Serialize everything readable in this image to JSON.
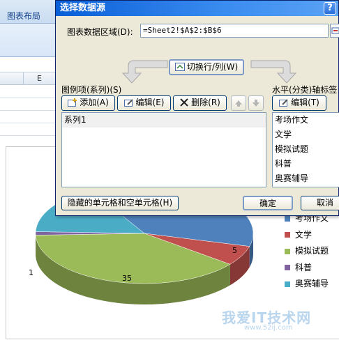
{
  "excel": {
    "ribbon_tab": "图表布局",
    "column_header": "E"
  },
  "dialog": {
    "title": "选择数据源",
    "help": "?",
    "range_label": "图表数据区域(D):",
    "range_value": "=Sheet2!$A$2:$B$6",
    "switch_label": "切换行/列(W)",
    "legend_group_label": "图例项(系列)(S)",
    "axis_group_label": "水平(分类)轴标签",
    "add_label": "添加(A)",
    "edit_label": "编辑(E)",
    "delete_label": "删除(R)",
    "axis_edit_label": "编辑(T)",
    "series": [
      "系列1"
    ],
    "categories": [
      "考场作文",
      "文学",
      "模拟试题",
      "科普",
      "奥赛辅导"
    ],
    "hidden_cells_label": "隐藏的单元格和空单元格(H)",
    "ok_label": "确定",
    "cancel_label": "取消"
  },
  "chart_data": {
    "type": "pie",
    "categories": [
      "考场作文",
      "文学",
      "模拟试题",
      "科普",
      "奥赛辅导"
    ],
    "legend_partial_first": "考场作文",
    "values": [
      null,
      5,
      35,
      1,
      null
    ],
    "data_labels": [
      "5",
      "35",
      "1"
    ],
    "colors": [
      "#4f81bd",
      "#c0504d",
      "#9bbb59",
      "#8064a2",
      "#4bacc6"
    ],
    "legend_position": "right"
  },
  "watermark": {
    "text": "我爱IT技术网",
    "url": "www.52ij.com"
  }
}
